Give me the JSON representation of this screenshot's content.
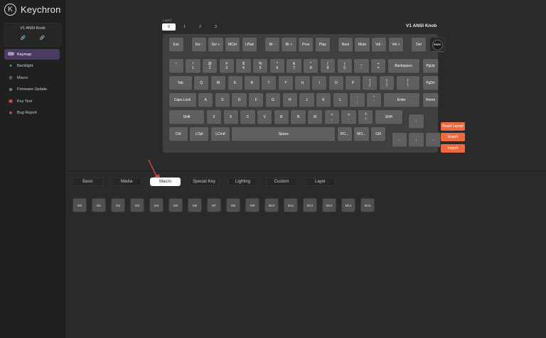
{
  "app": {
    "brand": "Keychron"
  },
  "device": {
    "name": "V1 ANSI Knob"
  },
  "sidebar": {
    "items": [
      {
        "label": "Keymap",
        "icon": "keyboard-icon",
        "active": true
      },
      {
        "label": "Backlight",
        "icon": "bulb-icon",
        "active": false
      },
      {
        "label": "Macro",
        "icon": "macro-icon",
        "active": false
      },
      {
        "label": "Firmware Update",
        "icon": "plus-circle-icon",
        "active": false
      },
      {
        "label": "Key Test",
        "icon": "keytest-icon",
        "active": false
      },
      {
        "label": "Bug Report",
        "icon": "bug-icon",
        "active": false
      }
    ]
  },
  "layer": {
    "label": "Layer",
    "tabs": [
      "0",
      "1",
      "2",
      "3"
    ],
    "active": "0"
  },
  "keyboard_title": "V1 ANSI Knob",
  "keys": [
    [
      {
        "l": "Esc"
      },
      {
        "l": "Scr -"
      },
      {
        "l": "Scr +"
      },
      {
        "l": "MCtrl"
      },
      {
        "l": "LPad"
      },
      {
        "l": "Br -"
      },
      {
        "l": "Br +"
      },
      {
        "l": "Prvs"
      },
      {
        "l": "Play"
      },
      {
        "l": "Next"
      },
      {
        "l": "Mute"
      },
      {
        "l": "Vol -"
      },
      {
        "l": "Vol +"
      },
      {
        "l": "Del"
      },
      {
        "l": "Mute",
        "knob": true
      }
    ],
    [
      {
        "l": "~\n`"
      },
      {
        "l": "!\n1"
      },
      {
        "l": "@\n2"
      },
      {
        "l": "#\n3"
      },
      {
        "l": "$\n4"
      },
      {
        "l": "%\n5"
      },
      {
        "l": "^\n6"
      },
      {
        "l": "&\n7"
      },
      {
        "l": "*\n8"
      },
      {
        "l": "(\n9"
      },
      {
        "l": ")\n0"
      },
      {
        "l": "_\n-"
      },
      {
        "l": "+\n="
      },
      {
        "l": "Backspace"
      },
      {
        "l": "PgUp"
      }
    ],
    [
      {
        "l": "Tab"
      },
      {
        "l": "Q"
      },
      {
        "l": "W"
      },
      {
        "l": "E"
      },
      {
        "l": "R"
      },
      {
        "l": "T"
      },
      {
        "l": "Y"
      },
      {
        "l": "U"
      },
      {
        "l": "I"
      },
      {
        "l": "O"
      },
      {
        "l": "P"
      },
      {
        "l": "{\n["
      },
      {
        "l": "}\n]"
      },
      {
        "l": "|\n\\"
      },
      {
        "l": "PgDn"
      }
    ],
    [
      {
        "l": "Caps Lock"
      },
      {
        "l": "A"
      },
      {
        "l": "S"
      },
      {
        "l": "D"
      },
      {
        "l": "F"
      },
      {
        "l": "G"
      },
      {
        "l": "H"
      },
      {
        "l": "J"
      },
      {
        "l": "K"
      },
      {
        "l": "L"
      },
      {
        "l": ":\n;"
      },
      {
        "l": "\"\n'"
      },
      {
        "l": "Enter"
      },
      {
        "l": "Home"
      }
    ],
    [
      {
        "l": "Shift"
      },
      {
        "l": "Z"
      },
      {
        "l": "X"
      },
      {
        "l": "C"
      },
      {
        "l": "V"
      },
      {
        "l": "B"
      },
      {
        "l": "N"
      },
      {
        "l": "M"
      },
      {
        "l": "<\n,"
      },
      {
        "l": ">\n."
      },
      {
        "l": "?\n/"
      },
      {
        "l": "Shift"
      },
      {
        "l": "↑"
      }
    ],
    [
      {
        "l": "Ctrl"
      },
      {
        "l": "LOpt"
      },
      {
        "l": "LCmd"
      },
      {
        "l": "Space"
      },
      {
        "l": "RC..."
      },
      {
        "l": "MO..."
      },
      {
        "l": "Ctrl"
      },
      {
        "l": "←"
      },
      {
        "l": "↓"
      },
      {
        "l": "→"
      }
    ]
  ],
  "actions": {
    "reset": "Reset Layout",
    "export": "Export",
    "import": "Import"
  },
  "categories": {
    "tabs": [
      "Basic",
      "Media",
      "Macro",
      "Special Key",
      "Lighting",
      "Custom",
      "Layer"
    ],
    "active": "Macro"
  },
  "macros": [
    "M0",
    "M1",
    "M2",
    "M3",
    "M4",
    "M5",
    "M6",
    "M7",
    "M8",
    "M9",
    "M10",
    "M11",
    "M12",
    "M13",
    "M14",
    "M15"
  ],
  "colors": {
    "accent": "#ec6a3f",
    "active_nav": "#4a3b62",
    "arrow": "#e24a3a"
  }
}
